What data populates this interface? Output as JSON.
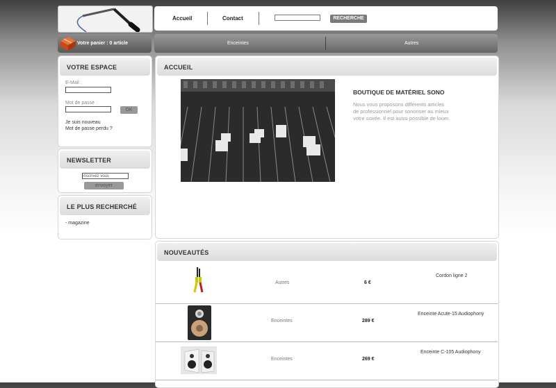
{
  "header": {
    "nav": {
      "home": "Accueil",
      "contact": "Contact"
    },
    "search": {
      "button": "RECHERCHE",
      "value": ""
    }
  },
  "cart": {
    "label": "Votre panier : 0 article"
  },
  "categories": [
    "Enceintes",
    "Autres"
  ],
  "sidebar": {
    "account": {
      "title": "VOTRE ESPACE",
      "email_label": "E-Mail :",
      "password_label": "Mot de passe :",
      "ok": "OK",
      "register": "Je suis nouveau",
      "lost_password": "Mot de passe perdu ?"
    },
    "newsletter": {
      "title": "NEWSLETTER",
      "placeholder": "Inscrivez vous",
      "button": "envoyer"
    },
    "popular": {
      "title": "LE PLUS RECHERCHÉ",
      "items": [
        "- magazine"
      ]
    }
  },
  "home": {
    "title": "ACCUEIL",
    "heading": "BOUTIQUE DE MATÉRIEL SONO",
    "text": [
      "Nous vous proposons différents articles",
      "de professionnel pour sonoriser au mieux",
      "votre soirée. Il est aussi possible de louer."
    ]
  },
  "news": {
    "title": "NOUVEAUTÉS",
    "products": [
      {
        "category": "Autres",
        "price": "6 €",
        "name": "Cordon ligne 2"
      },
      {
        "category": "Enceintes",
        "price": "289 €",
        "name": "Enceinte Acute-15 Audiophony"
      },
      {
        "category": "Enceintes",
        "price": "269 €",
        "name": "Enceinte C-105 Audiophony"
      }
    ]
  }
}
